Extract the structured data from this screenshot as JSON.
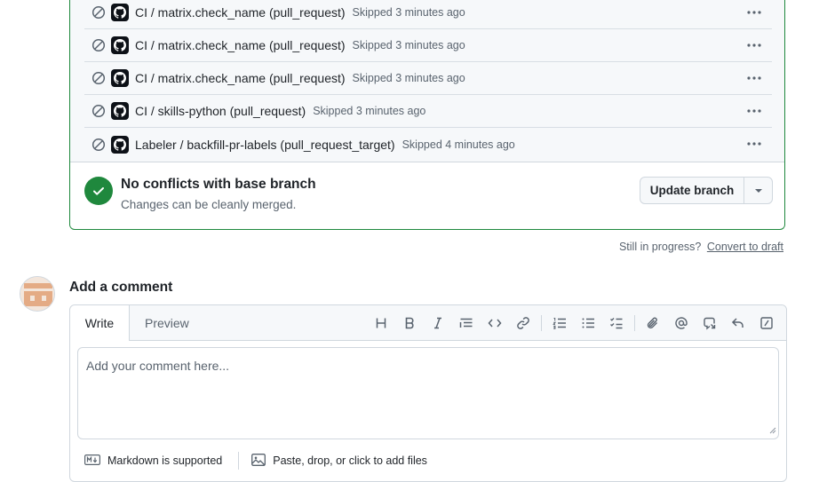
{
  "checks": [
    {
      "name": "CI / matrix.check_name (pull_request)",
      "status": "Skipped 3 minutes ago"
    },
    {
      "name": "CI / matrix.check_name (pull_request)",
      "status": "Skipped 3 minutes ago"
    },
    {
      "name": "CI / matrix.check_name (pull_request)",
      "status": "Skipped 3 minutes ago"
    },
    {
      "name": "CI / skills-python (pull_request)",
      "status": "Skipped 3 minutes ago"
    },
    {
      "name": "Labeler / backfill-pr-labels (pull_request_target)",
      "status": "Skipped 4 minutes ago"
    }
  ],
  "merge": {
    "title": "No conflicts with base branch",
    "subtitle": "Changes can be cleanly merged.",
    "update_button": "Update branch"
  },
  "draft": {
    "prompt": "Still in progress?",
    "link": "Convert to draft"
  },
  "comment": {
    "heading": "Add a comment",
    "tabs": [
      "Write",
      "Preview"
    ],
    "placeholder": "Add your comment here...",
    "footer_markdown": "Markdown is supported",
    "footer_files": "Paste, drop, or click to add files",
    "toolbar_icons": [
      "heading-icon",
      "bold-icon",
      "italic-icon",
      "quote-icon",
      "code-icon",
      "link-icon",
      "ordered-list-icon",
      "unordered-list-icon",
      "task-list-icon",
      "attach-icon",
      "mention-icon",
      "reference-icon",
      "reply-icon",
      "slash-command-icon"
    ]
  },
  "colors": {
    "success": "#1f883d",
    "muted": "#59636e",
    "border": "#d0d7de"
  }
}
